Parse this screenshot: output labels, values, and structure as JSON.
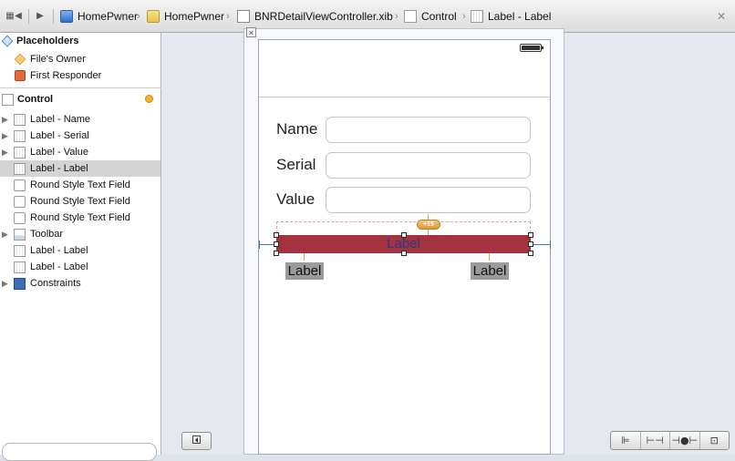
{
  "jumpbar": {
    "back": "◀",
    "forward": "▶",
    "crumbs": [
      "HomePwner",
      "HomePwner",
      "BNRDetailViewController.xib",
      "Control",
      "Label - Label"
    ]
  },
  "outline": {
    "placeholders_title": "Placeholders",
    "files_owner": "File's Owner",
    "first_responder": "First Responder",
    "control_title": "Control",
    "items": [
      "Label - Name",
      "Label - Serial",
      "Label - Value",
      "Label - Label",
      "Round Style Text Field",
      "Round Style Text Field",
      "Round Style Text Field",
      "Toolbar",
      "Label - Label",
      "Label - Label",
      "Constraints"
    ],
    "selected_index": 3
  },
  "canvas": {
    "name_label": "Name",
    "serial_label": "Serial",
    "value_label": "Value",
    "selected_label": "Label",
    "left_label": "Label",
    "right_label": "Label",
    "constraint_badge": "+15"
  },
  "icons": {
    "close": "close-icon",
    "battery": "battery-icon",
    "hide_outline": "sidebar-toggle-icon",
    "align": "align-icon",
    "pin": "pin-icon",
    "resolve": "resolve-issues-icon",
    "resizing": "resizing-icon"
  },
  "colors": {
    "selected_label_bg": "#a3343f",
    "selected_label_text": "#2b3a88",
    "constraint_line": "#3b74b8"
  }
}
